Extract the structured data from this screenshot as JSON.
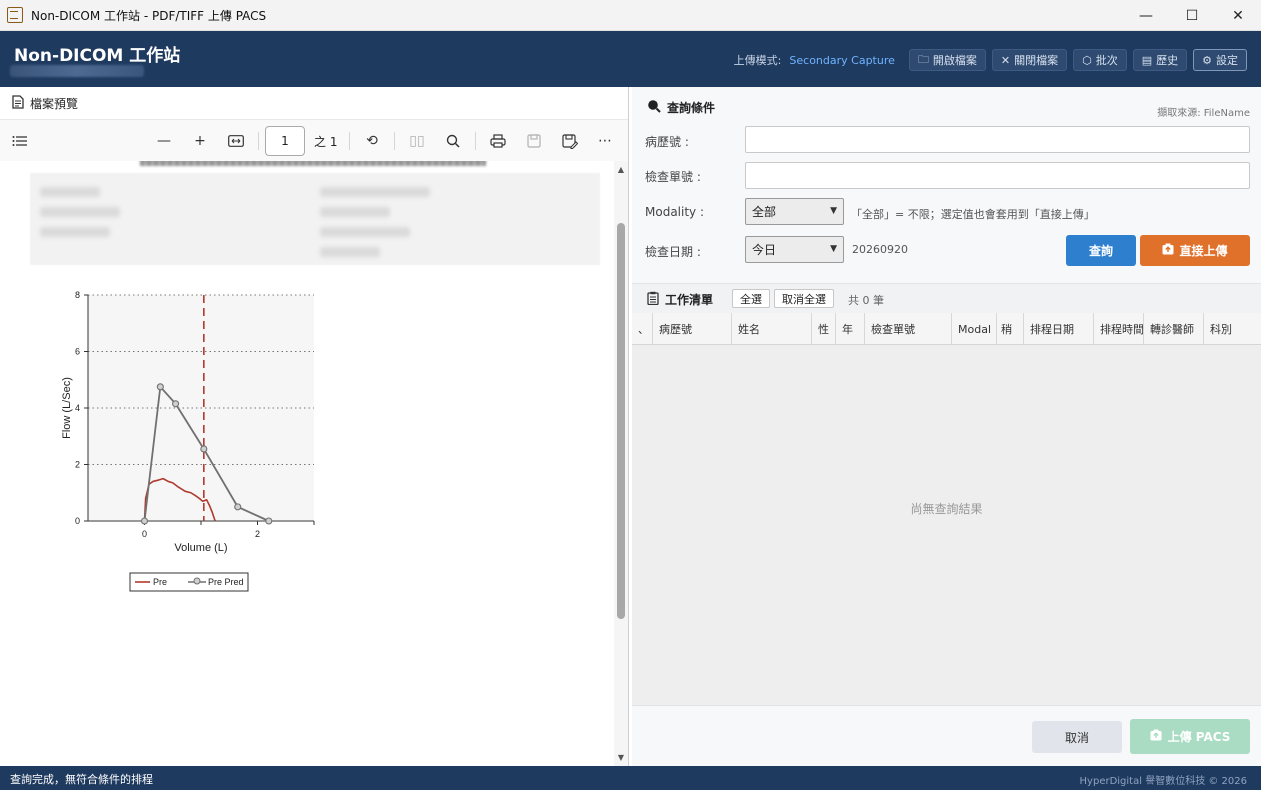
{
  "window": {
    "title": "Non-DICOM 工作站 - PDF/TIFF 上傳 PACS",
    "minimize": "—",
    "maximize": "☐",
    "close": "✕"
  },
  "header": {
    "app_name": "Non-DICOM 工作站",
    "upload_mode_label": "上傳模式:",
    "upload_mode_value": "Secondary Capture",
    "buttons": [
      {
        "label": "開啟檔案",
        "icon": "folder-icon"
      },
      {
        "label": "關閉檔案",
        "icon": "close-icon"
      },
      {
        "label": "批次",
        "icon": "box-icon"
      },
      {
        "label": "歷史",
        "icon": "history-icon"
      },
      {
        "label": "設定",
        "icon": "gear-icon"
      }
    ]
  },
  "preview": {
    "title": "檔案預覽",
    "page_number": "1",
    "page_total": "之 1"
  },
  "chart_data": {
    "type": "line",
    "xlabel": "Volume (L)",
    "ylabel": "Flow (L/Sec)",
    "x_ticks": [
      "0",
      "2"
    ],
    "y_ticks": [
      "0",
      "2",
      "4",
      "6",
      "8"
    ],
    "xlim": [
      -1,
      3
    ],
    "ylim": [
      0,
      8
    ],
    "grid": "horizontal-dotted",
    "reference_line_x": 1.05,
    "legend_position": "bottom",
    "series": [
      {
        "name": "Pre",
        "color": "#b03a2e",
        "x": [
          0.0,
          0.02,
          0.08,
          0.15,
          0.25,
          0.33,
          0.42,
          0.5,
          0.6,
          0.72,
          0.82,
          0.9,
          0.97,
          1.03,
          1.1,
          1.15,
          1.2,
          1.25
        ],
        "y": [
          0.0,
          0.8,
          1.3,
          1.4,
          1.45,
          1.5,
          1.4,
          1.35,
          1.2,
          1.05,
          1.0,
          0.9,
          0.8,
          0.7,
          0.75,
          0.55,
          0.3,
          0.0
        ]
      },
      {
        "name": "Pre Pred",
        "color": "#707070",
        "x": [
          0.0,
          0.28,
          0.55,
          1.05,
          1.65,
          2.2
        ],
        "y": [
          0.0,
          4.75,
          4.15,
          2.55,
          0.5,
          0.0
        ]
      }
    ]
  },
  "query": {
    "title": "查詢條件",
    "source_note": "擷取來源: FileName",
    "patient_id_label": "病歷號 :",
    "patient_id_value": "",
    "accession_label": "檢查單號 :",
    "accession_value": "",
    "modality_label": "Modality :",
    "modality_value": "全部",
    "modality_hint": "「全部」= 不限；選定值也會套用到「直接上傳」",
    "date_label": "檢查日期 :",
    "date_value": "今日",
    "date_text": "20260920",
    "query_button": "查詢",
    "direct_upload_button": "直接上傳"
  },
  "worklist": {
    "title": "工作清單",
    "select_all": "全選",
    "deselect_all": "取消全選",
    "count": "共 0 筆",
    "columns": [
      "、",
      "病歷號",
      "姓名",
      "性",
      "年",
      "檢查單號",
      "Modal",
      "稍",
      "排程日期",
      "排程時間",
      "轉診醫師",
      "科別"
    ],
    "empty_message": "尚無查詢結果"
  },
  "actions": {
    "cancel": "取消",
    "upload": "上傳 PACS"
  },
  "status": {
    "message": "查詢完成，無符合條件的排程",
    "copyright": "HyperDigital 譽智數位科技 © 2026"
  }
}
